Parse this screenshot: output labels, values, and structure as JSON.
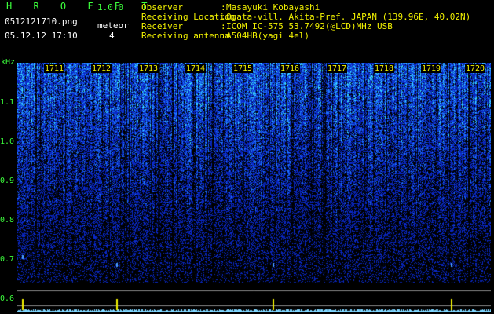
{
  "header": {
    "logo": "H R O F F T",
    "version": "1.0.0",
    "filename": "0512121710.png",
    "meteor_label": "meteor",
    "meteor_count": "4",
    "datetime": "05.12.12 17:10"
  },
  "info": [
    {
      "label": "Observer",
      "sep": ":",
      "value": "Masayuki Kobayashi"
    },
    {
      "label": "Receiving Location",
      "sep": ":",
      "value": "Ogata-vill. Akita-Pref. JAPAN (139.96E, 40.02N)"
    },
    {
      "label": "Receiver",
      "sep": ":",
      "value": "ICOM IC-575 53.7492(@LCD)MHz USB"
    },
    {
      "label": "Receiving antenna",
      "sep": ":",
      "value": "A504HB(yagi 4el)"
    }
  ],
  "axis": {
    "y_unit": "kHz",
    "y_ticks": [
      "1.1",
      "1.0",
      "0.9",
      "0.8",
      "0.7",
      "0.6"
    ],
    "x_ticks": [
      "1711",
      "1712",
      "1713",
      "1714",
      "1715",
      "1716",
      "1717",
      "1718",
      "1719",
      "1720"
    ]
  },
  "colors": {
    "background": "#000000",
    "text_yellow": "#f2f200",
    "text_green": "#3cff3c",
    "noise_blue": "#1e3cff",
    "noise_cyan": "#40e0ff",
    "signal_trace": "#7fd6ff",
    "meteor_marker": "#f2f200"
  }
}
